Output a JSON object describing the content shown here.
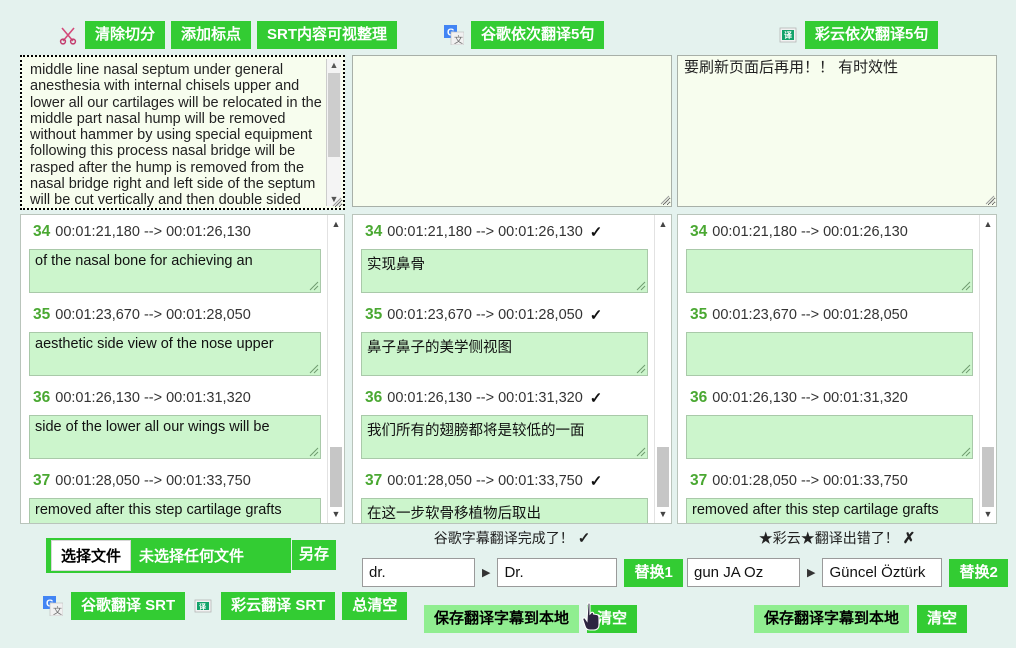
{
  "toolbars": {
    "left": {
      "icon": "scissors-icon",
      "buttons": [
        "清除切分",
        "添加标点",
        "SRT内容可视整理"
      ]
    },
    "middle": {
      "icon": "google-translate-icon",
      "buttons": [
        "谷歌依次翻译5句"
      ]
    },
    "right": {
      "icon": "caiyun-translate-icon",
      "buttons": [
        "彩云依次翻译5句"
      ]
    }
  },
  "bigboxes": {
    "left": "middle line nasal septum under general anesthesia with internal chisels upper and lower all our cartilages will be relocated in the middle part nasal hump will be removed without hammer by using special equipment following this process nasal bridge will be rasped after the hump is removed from the nasal bridge right and left side of the septum will be cut vertically and then double sided horizontal cuts will be done at the top of the nasal bone for achieving an",
    "middle": "",
    "right": "要刷新页面后再用！！ 有时效性"
  },
  "subtitles": {
    "rows": [
      {
        "num": "34",
        "time": "00:01:21,180 --> 00:01:26,130"
      },
      {
        "num": "35",
        "time": "00:01:23,670 --> 00:01:28,050"
      },
      {
        "num": "36",
        "time": "00:01:26,130 --> 00:01:31,320"
      },
      {
        "num": "37",
        "time": "00:01:28,050 --> 00:01:33,750"
      }
    ],
    "source_texts": [
      "of the nasal bone for achieving an",
      "aesthetic side view of the nose upper",
      "side of the lower all our wings will be",
      "removed after this step cartilage grafts"
    ],
    "google_texts": [
      "实现鼻骨",
      "鼻子鼻子的美学侧视图",
      "我们所有的翅膀都将是较低的一面",
      "在这一步软骨移植物后取出"
    ],
    "google_checks": [
      "✓",
      "✓",
      "✓",
      "✓"
    ],
    "caiyun_texts": [
      "",
      "",
      "",
      "removed after this step cartilage grafts"
    ],
    "caiyun_checks": [
      "",
      "",
      "",
      ""
    ]
  },
  "left_bottom": {
    "choose_file_label": "选择文件",
    "file_name": "未选择任何文件",
    "save_as_label": "另存",
    "google_srt_label": "谷歌翻译 SRT",
    "caiyun_srt_label": "彩云翻译 SRT",
    "clear_all_label": "总清空",
    "google_icon": "google-translate-icon",
    "caiyun_icon": "caiyun-translate-icon"
  },
  "middle_bottom": {
    "status_text": "谷歌字幕翻译完成了！",
    "status_mark": "✓",
    "find_value": "dr.",
    "replace_value": "Dr.",
    "replace_button": "替换1",
    "save_button": "保存翻译字幕到本地",
    "clear_button": "清空"
  },
  "right_bottom": {
    "status_text": "★彩云★翻译出错了！",
    "status_mark": "✗",
    "find_value": "gun JA Oz",
    "replace_value": "Güncel Öztürk",
    "replace_button": "替换2",
    "save_button": "保存翻译字幕到本地",
    "clear_button": "清空"
  },
  "colors": {
    "page_bg": "#e4f2ee",
    "button_green": "#33cc33",
    "button_light_green": "#90ee90",
    "textarea_bg": "#f7fdee",
    "subtitle_text_bg": "#ccf5cc",
    "number_green": "#4aa832"
  }
}
